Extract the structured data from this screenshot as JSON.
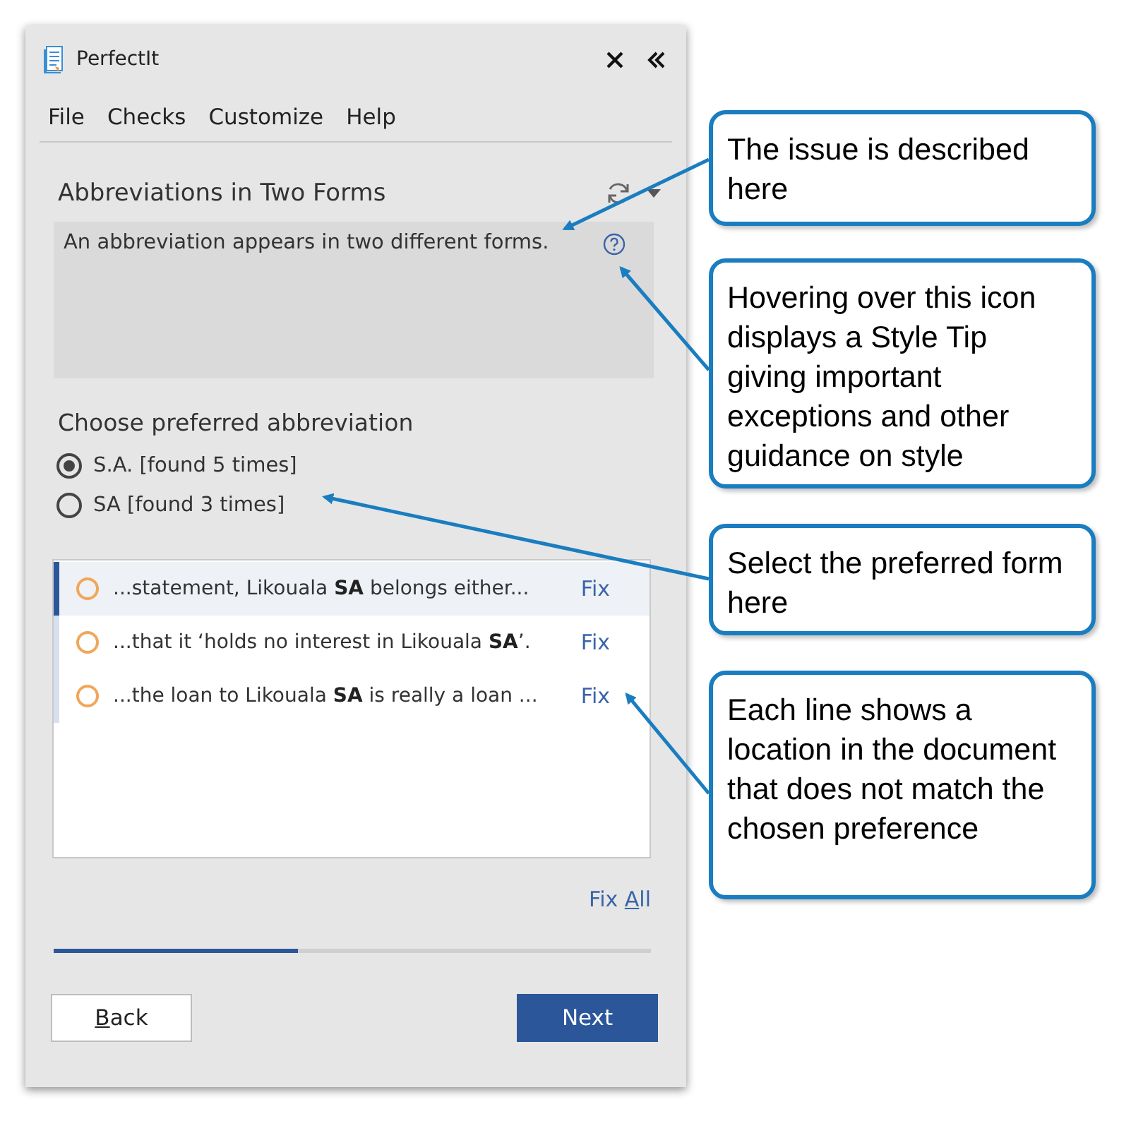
{
  "window": {
    "title": "PerfectIt"
  },
  "menu": [
    "File",
    "Checks",
    "Customize",
    "Help"
  ],
  "issue": {
    "title": "Abbreviations in Two Forms",
    "description": "An abbreviation appears in two different forms."
  },
  "choice": {
    "heading": "Choose preferred abbreviation",
    "options": [
      {
        "label": "S.A. [found 5 times]",
        "selected": true
      },
      {
        "label": "SA [found 3 times]",
        "selected": false
      }
    ]
  },
  "locations": [
    {
      "text": "...statement,  Likouala **SA** belongs either...",
      "fix": "Fix",
      "selected": true
    },
    {
      "text": "...that it ‘holds no interest in Likouala **SA**’.",
      "fix": "Fix",
      "selected": false
    },
    {
      "text": "...the loan to Likouala **SA** is really a loan ...",
      "fix": "Fix",
      "selected": false
    }
  ],
  "fix_all": {
    "label_before": "Fix ",
    "access_key": "A",
    "label_after": "ll"
  },
  "progress": {
    "level": 0.41
  },
  "buttons": [
    {
      "access_key": "B",
      "label_after": "ack",
      "kind": "secondary"
    },
    {
      "label_before": "Next",
      "kind": "primary"
    }
  ],
  "callouts": [
    {
      "text": "The issue is described here"
    },
    {
      "text": "Hovering over this icon displays a Style Tip giving important exceptions and other guidance on style"
    },
    {
      "text": "Select the preferred form here"
    },
    {
      "text": "Each line shows a location in the document that does not match the chosen preference"
    }
  ]
}
